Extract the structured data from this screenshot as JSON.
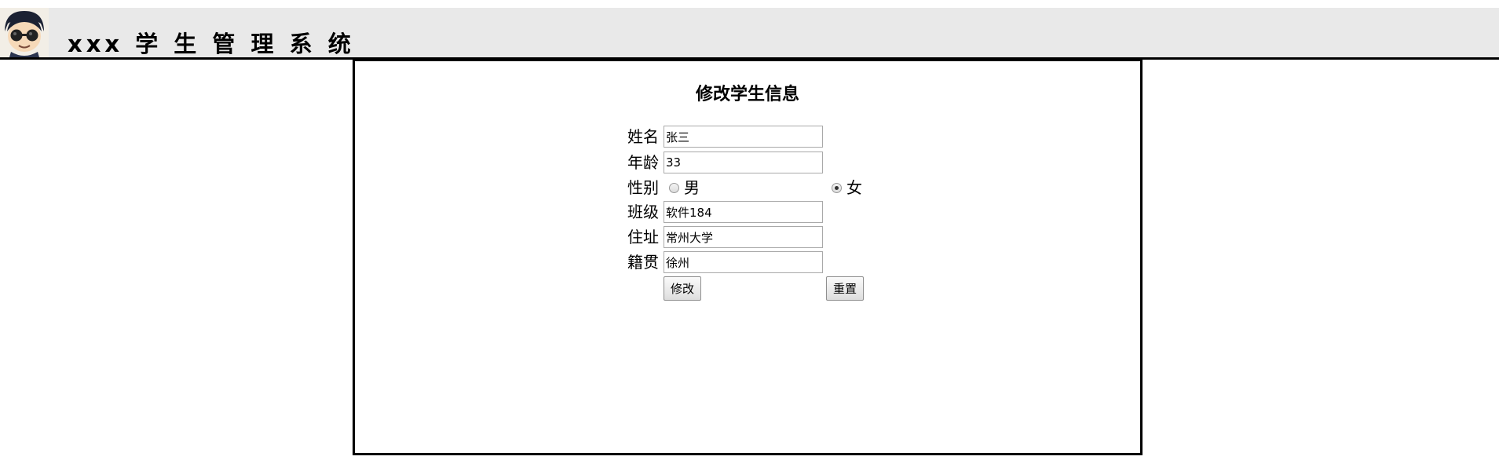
{
  "header": {
    "title": "xxx 学 生 管 理 系 统",
    "avatar_icon": "cartoon-avatar-icon"
  },
  "form": {
    "title": "修改学生信息",
    "fields": {
      "name": {
        "label": "姓名",
        "value": "张三"
      },
      "age": {
        "label": "年龄",
        "value": "33"
      },
      "gender": {
        "label": "性别",
        "options": [
          "男",
          "女"
        ],
        "selected": "女"
      },
      "class": {
        "label": "班级",
        "value": "软件184"
      },
      "address": {
        "label": "住址",
        "value": "常州大学"
      },
      "hometown": {
        "label": "籍贯",
        "value": "徐州"
      }
    },
    "buttons": {
      "submit": "修改",
      "reset": "重置"
    }
  },
  "colors": {
    "header_bg": "#e9e9e9",
    "border": "#000000"
  }
}
